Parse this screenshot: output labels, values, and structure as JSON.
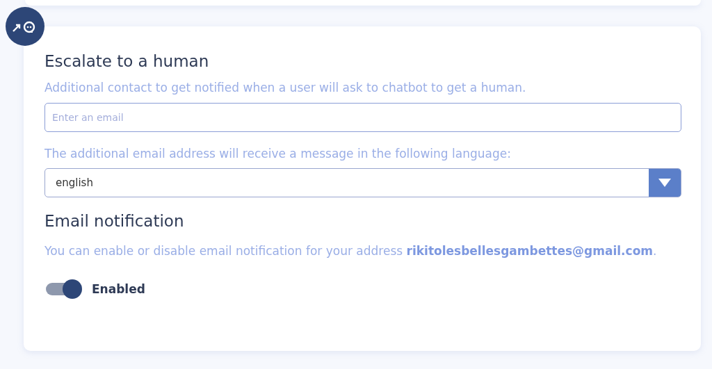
{
  "escalate": {
    "title": "Escalate to a human",
    "description": "Additional contact to get notified when a user will ask to chatbot to get a human.",
    "email_field": {
      "placeholder": "Enter an email"
    },
    "language_label": "The additional email address will receive a message in the following language:",
    "language_select": {
      "value": "english"
    }
  },
  "notification": {
    "title": "Email notification",
    "description": "You can enable or disable email notification for your address **rikitolesbellesgambettes@gmail.com**.",
    "toggle": {
      "on": true,
      "label": "Enabled"
    }
  }
}
